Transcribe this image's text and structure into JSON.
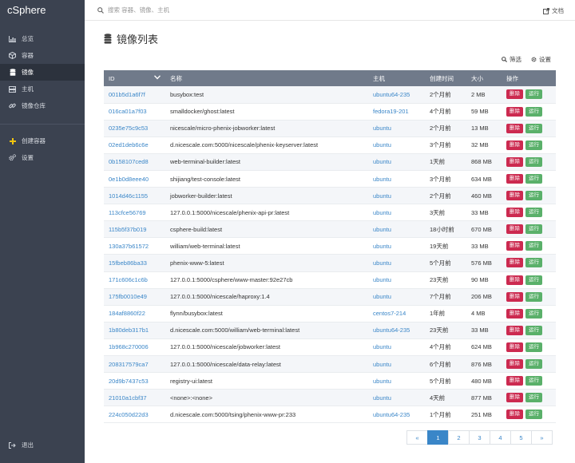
{
  "app": {
    "brand": "cSphere"
  },
  "sidebar": {
    "items": [
      {
        "label": "总览",
        "icon": "bar-chart-icon",
        "active": false
      },
      {
        "label": "容器",
        "icon": "cube-icon",
        "active": false
      },
      {
        "label": "镜像",
        "icon": "database-icon",
        "active": true
      },
      {
        "label": "主机",
        "icon": "server-icon",
        "active": false
      },
      {
        "label": "镜像仓库",
        "icon": "link-icon",
        "active": false
      }
    ],
    "actions": [
      {
        "label": "创建容器",
        "icon": "plus-icon"
      },
      {
        "label": "设置",
        "icon": "gears-icon"
      }
    ],
    "logout": {
      "label": "退出",
      "icon": "sign-out-icon"
    }
  },
  "topbar": {
    "search_placeholder": "搜索 容器、镜像、主机",
    "docs_label": "文档"
  },
  "page": {
    "title": "镜像列表",
    "filter_label": "筛选",
    "settings_label": "设置"
  },
  "table": {
    "headers": {
      "id": "ID",
      "name": "名称",
      "host": "主机",
      "created": "创建时间",
      "size": "大小",
      "actions": "操作"
    },
    "delete_label": "删除",
    "run_label": "运行",
    "rows": [
      {
        "id": "001b5d1a6f7f",
        "name": "busybox:test",
        "host": "ubuntu64-235",
        "created": "2个月前",
        "size": "2 MB"
      },
      {
        "id": "016ca01a7f03",
        "name": "smalldocker/ghost:latest",
        "host": "fedora19-201",
        "created": "4个月前",
        "size": "59 MB"
      },
      {
        "id": "0235e75c9c53",
        "name": "nicescale/micro-phenix-jobworker:latest",
        "host": "ubuntu",
        "created": "2个月前",
        "size": "13 MB"
      },
      {
        "id": "02ed1deb6c6e",
        "name": "d.nicescale.com:5000/nicescale/phenix-keyserver:latest",
        "host": "ubuntu",
        "created": "3个月前",
        "size": "32 MB"
      },
      {
        "id": "0b158107ced8",
        "name": "web-terminal-builder:latest",
        "host": "ubuntu",
        "created": "1天前",
        "size": "868 MB"
      },
      {
        "id": "0e1b0d8eee40",
        "name": "shijiang/test-console:latest",
        "host": "ubuntu",
        "created": "3个月前",
        "size": "634 MB"
      },
      {
        "id": "1014d46c1155",
        "name": "jobworker-builder:latest",
        "host": "ubuntu",
        "created": "2个月前",
        "size": "460 MB"
      },
      {
        "id": "113cfce56769",
        "name": "127.0.0.1:5000/nicescale/phenix-api-pr:latest",
        "host": "ubuntu",
        "created": "3天前",
        "size": "33 MB"
      },
      {
        "id": "115b5f37b019",
        "name": "csphere-build:latest",
        "host": "ubuntu",
        "created": "18小时前",
        "size": "670 MB"
      },
      {
        "id": "130a37b61572",
        "name": "william/web-terminal:latest",
        "host": "ubuntu",
        "created": "19天前",
        "size": "33 MB"
      },
      {
        "id": "15fbeb86ba33",
        "name": "phenix-www-5:latest",
        "host": "ubuntu",
        "created": "5个月前",
        "size": "576 MB"
      },
      {
        "id": "171c606c1c6b",
        "name": "127.0.0.1:5000/csphere/www-master:92e27cb",
        "host": "ubuntu",
        "created": "23天前",
        "size": "90 MB"
      },
      {
        "id": "175fb0010e49",
        "name": "127.0.0.1:5000/nicescale/haproxy:1.4",
        "host": "ubuntu",
        "created": "7个月前",
        "size": "206 MB"
      },
      {
        "id": "184af8860f22",
        "name": "flynn/busybox:latest",
        "host": "centos7-214",
        "created": "1年前",
        "size": "4 MB"
      },
      {
        "id": "1b80deb317b1",
        "name": "d.nicescale.com:5000/william/web-terminal:latest",
        "host": "ubuntu64-235",
        "created": "23天前",
        "size": "33 MB"
      },
      {
        "id": "1b968c270006",
        "name": "127.0.0.1:5000/nicescale/jobworker:latest",
        "host": "ubuntu",
        "created": "4个月前",
        "size": "624 MB"
      },
      {
        "id": "208317579ca7",
        "name": "127.0.0.1:5000/nicescale/data-relay:latest",
        "host": "ubuntu",
        "created": "6个月前",
        "size": "876 MB"
      },
      {
        "id": "20d9b7437c53",
        "name": "registry-ui:latest",
        "host": "ubuntu",
        "created": "5个月前",
        "size": "480 MB"
      },
      {
        "id": "21010a1cbf37",
        "name": "<none>:<none>",
        "host": "ubuntu",
        "created": "4天前",
        "size": "877 MB"
      },
      {
        "id": "224c050d22d3",
        "name": "d.nicescale.com:5000/tsing/phenix-www-pr:233",
        "host": "ubuntu64-235",
        "created": "1个月前",
        "size": "251 MB"
      }
    ]
  },
  "pagination": {
    "prev": "«",
    "pages": [
      "1",
      "2",
      "3",
      "4",
      "5"
    ],
    "next": "»",
    "current": "1"
  },
  "colors": {
    "sidebar_bg": "#3b4250",
    "header_bg": "#707a8a",
    "link": "#3a86c8",
    "delete": "#cc2a50",
    "run": "#5ab06a"
  }
}
